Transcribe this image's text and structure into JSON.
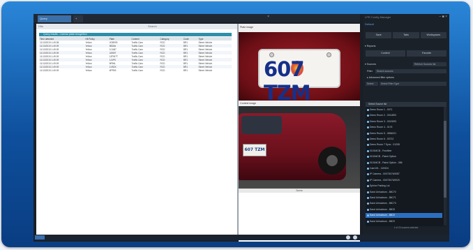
{
  "window": {
    "tabs": [
      {
        "label": "Query"
      },
      {
        "label": "+"
      }
    ],
    "close": "×"
  },
  "left_panel": {
    "header_left": "Hits",
    "header_mid": "Search",
    "grid_title": "Query results - License plate recognition",
    "columns": [
      "Time detected",
      "Hit Policy",
      "Plate",
      "Context",
      "Category",
      "Code",
      "Type"
    ],
    "rows": [
      [
        "11/13/2015 1:49:08",
        "Yellow",
        "0GB909",
        "Traffic Cam",
        "RCD",
        "BR1",
        "Street Vehicle"
      ],
      [
        "11/13/2015 1:49:09",
        "Yellow",
        "5BD6x",
        "Traffic Cam",
        "RCD",
        "BR1",
        "Street Vehicle"
      ],
      [
        "11/13/2015 1:49:09",
        "Yellow",
        "1CAB7",
        "Traffic Cam",
        "RCD",
        "BR1",
        "Street Vehicle"
      ],
      [
        "11/13/2015 1:49:09",
        "Yellow",
        "LBN97",
        "Traffic Cam",
        "RCD",
        "BR1",
        "Street Vehicle"
      ],
      [
        "11/13/2015 1:49:09",
        "Yellow",
        "1ZPM7T",
        "Traffic Cam",
        "RCD",
        "BR1",
        "Street Vehicle"
      ],
      [
        "11/13/2015 1:49:09",
        "Yellow",
        "1J4P5",
        "Traffic Cam",
        "RCD",
        "BR1",
        "Street Vehicle"
      ],
      [
        "11/13/2015 1:49:09",
        "Yellow",
        "8R94L",
        "Traffic Cam",
        "RCD",
        "BR1",
        "Street Vehicle"
      ],
      [
        "11/13/2015 1:49:09",
        "Yellow",
        "1VB2X",
        "Traffic Cam",
        "RCD",
        "BR1",
        "Street Vehicle"
      ],
      [
        "11/13/2015 1:49:09",
        "Yellow",
        "6PR93",
        "Traffic Cam",
        "RCD",
        "BR1",
        "Street Vehicle"
      ]
    ]
  },
  "images": {
    "plate_label": "Plate image",
    "context_label": "Context image",
    "plate_text": "607 TZM",
    "car_plate_text": "607 TZM",
    "footer": "Scene"
  },
  "right_panel": {
    "title": "LPR Config Manager",
    "window_buttons": "– ■ ×",
    "link": "Default",
    "buttons_row1": [
      "Save",
      "Tabs",
      "Workspaces"
    ],
    "section_reports": "▾ Reports",
    "buttons_row2": [
      "Context",
      "Favorite"
    ],
    "section_sources": "▾ Sources",
    "sources_action": "Refresh Sources list",
    "filter_label": "Filter",
    "filter_value": "Search sources",
    "advanced": "▸ Advanced filter options",
    "select_all": "Select",
    "select_value": "Select Filter Type",
    "list_header": "Select Source list",
    "list_items": [
      "Demo Room 1 - 0071",
      "Demo Room 2 - 0011893",
      "Demo Room 3 - 0013093",
      "Demo Room 4 - 0176",
      "Demo Room 5 - 0654021",
      "Demo Room 6 - 00712",
      "Demo Room 7 Sync - 01208",
      "0101MCB - Frontline",
      "0101MCB - Patrol Option",
      "0101MCB - Patrol Option - 086",
      "Cam101 - 119324",
      "IP Camera - 0007D07A9087",
      "IP Camera - 0007D07A9020",
      "Sphinx Parking Lot",
      "Sand Unhadrum - 88C70",
      "Sand Unhadrum - 88C71",
      "Sand Unhadrum - 88C73",
      "Sand Unhadrum - 88C8",
      "Sand Unhadrum - 88C9",
      "Sand Unhadrum - 88C9"
    ],
    "selected_index": 18,
    "list_footer": "1 of 20 sources selected",
    "bottom_section": "▸ Bookmarks"
  }
}
